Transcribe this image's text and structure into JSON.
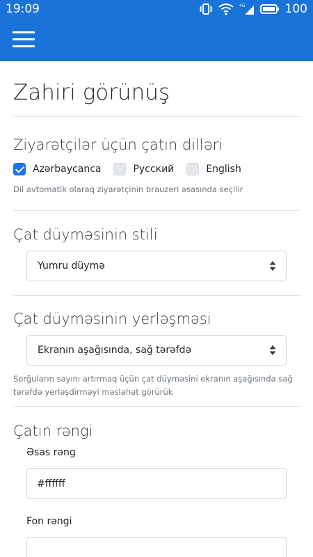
{
  "status_bar": {
    "time": "19:09",
    "battery_level": "100",
    "network_type": "4G",
    "icons": [
      "vibrate-icon",
      "wifi-icon",
      "cellular-signal-icon",
      "battery-icon"
    ]
  },
  "app_bar": {
    "menu_icon": "hamburger-menu-icon",
    "color": "#1a73d9"
  },
  "page": {
    "title": "Zahiri görünüş"
  },
  "languages": {
    "heading": "Ziyarətçilər üçün çatın dilləri",
    "options": [
      {
        "label": "Azərbaycanca",
        "checked": true
      },
      {
        "label": "Русский",
        "checked": false
      },
      {
        "label": "English",
        "checked": false
      }
    ],
    "help": "Dil avtomatik olaraq ziyarətçinin brauzeri əsasında seçilir"
  },
  "button_style": {
    "heading": "Çat düyməsinin stili",
    "selected": "Yumru düymə"
  },
  "button_position": {
    "heading": "Çat düyməsinin yerləşməsi",
    "selected": "Ekranın aşağısında, sağ tərəfdə",
    "help": "Sorğuların sayını artırmaq üçün çat düyməsini ekranın aşağısında sağ tərəfdə yerləşdirməyi məsləhət görürük"
  },
  "chat_color": {
    "heading": "Çatın rəngi",
    "main_color_label": "Əsas rəng",
    "main_color_value": "#ffffff",
    "background_color_label": "Fon rəngi",
    "background_color_value": ""
  },
  "colors": {
    "accent": "#1a73e8",
    "divider": "#e3e3e3"
  }
}
